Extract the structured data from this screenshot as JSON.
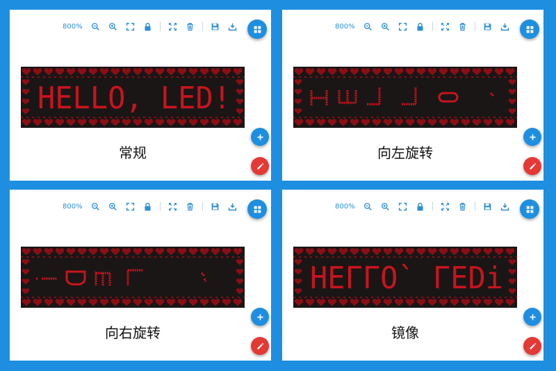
{
  "colors": {
    "accent": "#1e8fe0",
    "danger": "#e53935",
    "led_on": "#c8141e",
    "led_frame": "#8a0e14",
    "led_bg": "#1a1616"
  },
  "toolbar": {
    "zoom_label": "800%",
    "icons": [
      "zoom-out-icon",
      "zoom-in-icon",
      "fit-screen-icon",
      "lock-icon",
      "fullscreen-icon",
      "delete-icon",
      "save-icon",
      "download-icon"
    ]
  },
  "panels": [
    {
      "caption": "常规",
      "display_text": "HELLO, LED!",
      "mode": "normal"
    },
    {
      "caption": "向左旋转",
      "display_text": "HELLO, LED!",
      "mode": "rotate-left"
    },
    {
      "caption": "向右旋转",
      "display_text": "HELLO, LED!",
      "mode": "rotate-right"
    },
    {
      "caption": "镜像",
      "display_text": "HELLO, LED!",
      "mode": "mirror"
    }
  ]
}
